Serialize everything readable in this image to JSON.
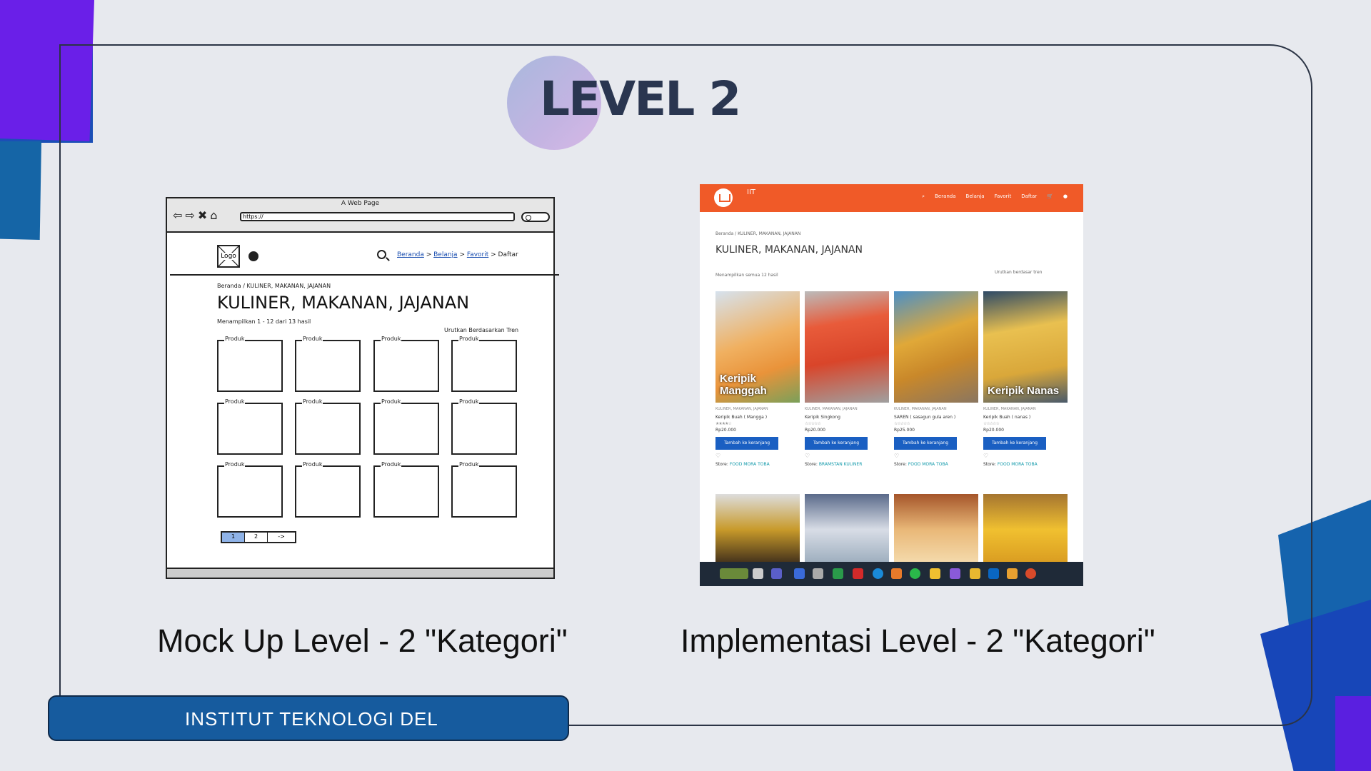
{
  "slide": {
    "title": "LEVEL 2",
    "caption_left": "Mock Up Level - 2 \"Kategori\"",
    "caption_right": "Implementasi Level - 2 \"Kategori\"",
    "footer": "INSTITUT TEKNOLOGI DEL"
  },
  "mockup": {
    "window_title": "A Web Page",
    "url": "https://",
    "logo": "Logo",
    "nav": {
      "beranda": "Beranda",
      "belanja": "Belanja",
      "favorit": "Favorit",
      "daftar": "Daftar"
    },
    "breadcrumb": "Beranda / KULINER, MAKANAN, JAJANAN",
    "heading": "KULINER, MAKANAN, JAJANAN",
    "result_count": "Menampilkan 1 - 12 dari 13 hasil",
    "sort": "Urutkan Berdasarkan Tren",
    "product_label": "Produk",
    "pagination": [
      "1",
      "2",
      "->"
    ]
  },
  "implementation": {
    "brand": "IIT",
    "nav": [
      "Beranda",
      "Belanja",
      "Favorit",
      "Daftar"
    ],
    "breadcrumb": "Beranda / KULINER, MAKANAN, JAJANAN",
    "heading": "KULINER, MAKANAN, JAJANAN",
    "result_count": "Menampilkan semua 12 hasil",
    "sort": "Urutkan berdasar tren",
    "products": [
      {
        "caption": "Keripik Manggah",
        "category": "KULINER, MAKANAN, JAJANAN",
        "name": "Keripik Buah ( Mangga )",
        "price": "Rp20.000",
        "button": "Tambah ke keranjang",
        "store": "FOOD MORA TOBA"
      },
      {
        "caption": "",
        "category": "KULINER, MAKANAN, JAJANAN",
        "name": "Keripik Singkong",
        "price": "Rp20.000",
        "button": "Tambah ke keranjang",
        "store": "BRAMSTAN KULINER"
      },
      {
        "caption": "",
        "category": "KULINER, MAKANAN, JAJANAN",
        "name": "SAREN ( sasagun gula aren )",
        "price": "Rp25.000",
        "button": "Tambah ke keranjang",
        "store": "FOOD MORA TOBA"
      },
      {
        "caption": "Keripik Nanas",
        "category": "KULINER, MAKANAN, JAJANAN",
        "name": "Keripik Buah ( nanas )",
        "price": "Rp20.000",
        "button": "Tambah ke keranjang",
        "store": "FOOD MORA TOBA"
      }
    ],
    "store_prefix": "Store:"
  },
  "colors": {
    "accent": "#165b9e",
    "header_orange": "#f05a28",
    "button_blue": "#1a5fc2"
  }
}
